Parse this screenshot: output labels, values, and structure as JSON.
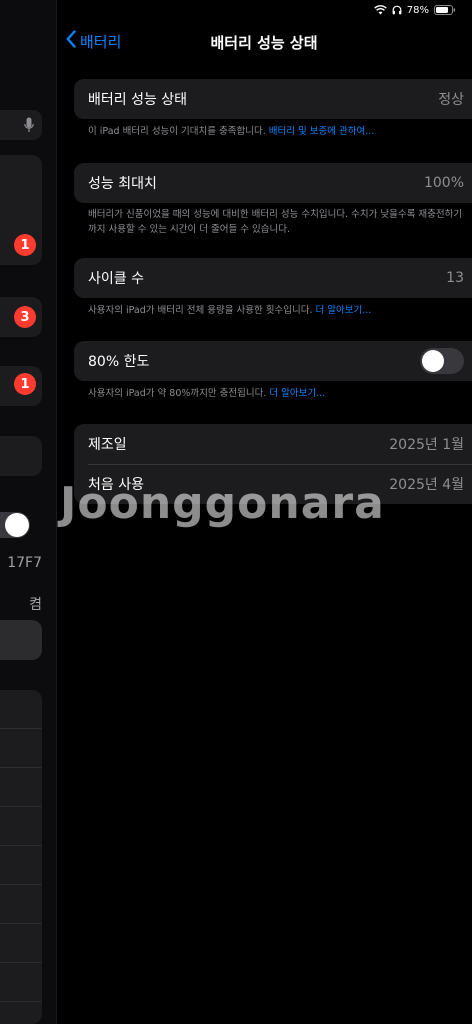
{
  "status": {
    "battery": "78%"
  },
  "sidebar": {
    "badges": [
      "1",
      "3",
      "1"
    ],
    "texts": [
      "17F7",
      "켬"
    ]
  },
  "nav": {
    "back_label": "배터리",
    "title": "배터리 성능 상태"
  },
  "groups": {
    "health": {
      "label": "배터리 성능 상태",
      "value": "정상"
    },
    "health_footer": {
      "text": "이 iPad 배터리 성능이 기대치를 충족합니다. ",
      "link": "배터리 및 보증에 관하여..."
    },
    "capacity": {
      "label": "성능 최대치",
      "value": "100%"
    },
    "capacity_footer": {
      "text": "배터리가 신품이었을 때의 성능에 대비한 배터리 성능 수치입니다. 수치가 낮을수록 재충전하기까지 사용할 수 있는 시간이 더 줄어들 수 있습니다."
    },
    "cycle": {
      "label": "사이클 수",
      "value": "13"
    },
    "cycle_footer": {
      "text": "사용자의 iPad가 배터리 전체 용량을 사용한 횟수입니다. ",
      "link": "더 알아보기..."
    },
    "limit": {
      "label": "80% 한도",
      "on": false
    },
    "limit_footer": {
      "text": "사용자의 iPad가 약 80%까지만 충전됩니다. ",
      "link": "더 알아보기..."
    },
    "dates": {
      "manufacture_label": "제조일",
      "manufacture_value": "2025년 1월",
      "first_use_label": "처음 사용",
      "first_use_value": "2025년 4월"
    }
  },
  "watermark": "Joonggonara",
  "colors": {
    "accent": "#0a84ff",
    "badge": "#ff3b30",
    "cell": "#1c1c1e",
    "background": "#000000"
  }
}
